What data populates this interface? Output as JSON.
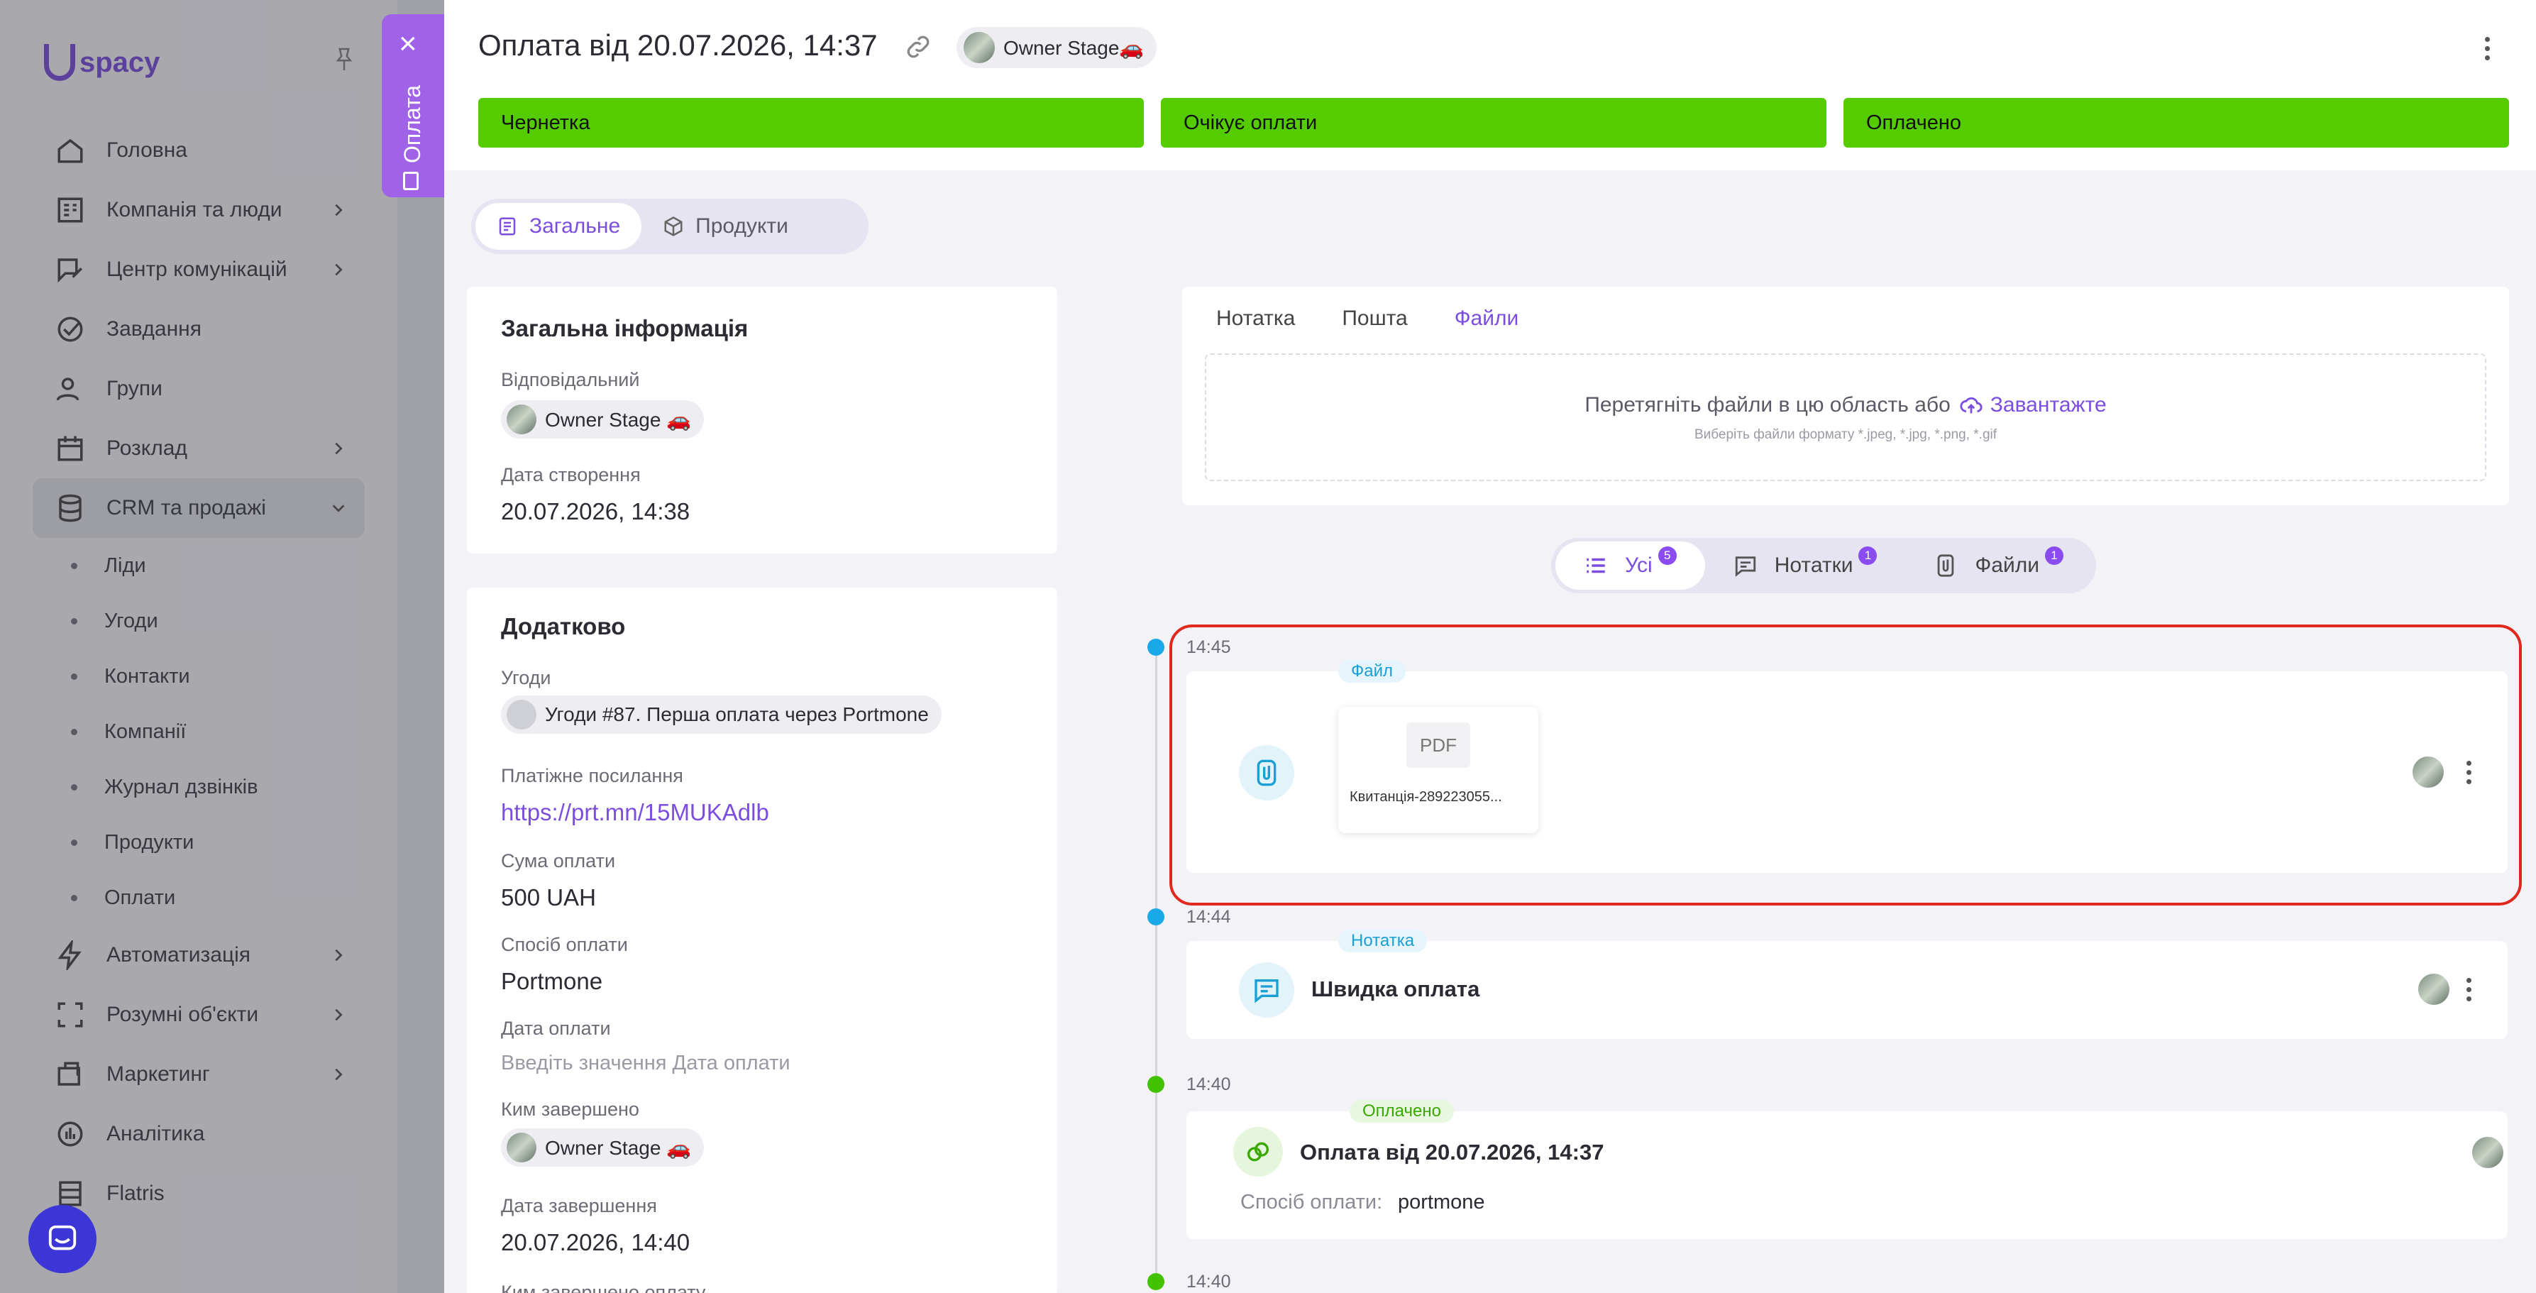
{
  "sidebar": {
    "logo_text": "spacy",
    "items": [
      {
        "label": "Головна",
        "icon": "home-icon"
      },
      {
        "label": "Компанія та люди",
        "icon": "building-icon"
      },
      {
        "label": "Центр комунікацій",
        "icon": "chat-edit-icon"
      },
      {
        "label": "Завдання",
        "icon": "check-circle-icon"
      },
      {
        "label": "Групи",
        "icon": "users-icon"
      },
      {
        "label": "Розклад",
        "icon": "calendar-icon"
      },
      {
        "label": "CRM та продажі",
        "icon": "database-icon"
      }
    ],
    "crm_subitems": [
      "Ліди",
      "Угоди",
      "Контакти",
      "Компанії",
      "Журнал дзвінків",
      "Продукти",
      "Оплати"
    ],
    "items_bottom": [
      {
        "label": "Автоматизація",
        "icon": "bolt-icon"
      },
      {
        "label": "Розумні об'єкти",
        "icon": "scan-icon"
      },
      {
        "label": "Маркетинг",
        "icon": "marketing-icon"
      },
      {
        "label": "Аналітика",
        "icon": "analytics-icon"
      },
      {
        "label": "Flatris",
        "icon": "flatris-icon"
      }
    ]
  },
  "side_tab": {
    "label": "Оплата"
  },
  "header": {
    "title": "Оплата від 20.07.2026, 14:37",
    "owner": "Owner Stage🚗"
  },
  "stages": [
    "Чернетка",
    "Очікує оплати",
    "Оплачено"
  ],
  "tabs": [
    "Загальне",
    "Продукти"
  ],
  "general": {
    "title": "Загальна інформація",
    "responsible_label": "Відповідальний",
    "responsible": "Owner Stage 🚗",
    "created_label": "Дата створення",
    "created": "20.07.2026, 14:38"
  },
  "extra": {
    "title": "Додатково",
    "deals_label": "Угоди",
    "deal": "Угоди #87. Перша оплата через Portmone",
    "paylink_label": "Платіжне посилання",
    "paylink": "https://prt.mn/15MUKAdlb",
    "amount_label": "Сума оплати",
    "amount": "500 UAH",
    "method_label": "Спосіб оплати",
    "method": "Portmone",
    "paydate_label": "Дата оплати",
    "paydate_placeholder": "Введіть значення Дата оплати",
    "completed_by_label": "Ким завершено",
    "completed_by": "Owner Stage 🚗",
    "completed_date_label": "Дата завершення",
    "completed_date": "20.07.2026, 14:40",
    "cut_label": "Ким завершено оплату"
  },
  "upload": {
    "tabs": [
      "Нотатка",
      "Пошта",
      "Файли"
    ],
    "drop_text": "Перетягніть файли в цю область або",
    "upload_link": "Завантажте",
    "hint": "Виберіть файли формату *.jpeg, *.jpg, *.png, *.gif"
  },
  "filter": [
    {
      "label": "Усі",
      "count": "5"
    },
    {
      "label": "Нотатки",
      "count": "1"
    },
    {
      "label": "Файли",
      "count": "1"
    }
  ],
  "timeline": [
    {
      "time": "14:45",
      "tag": "Файл",
      "file_type": "PDF",
      "file_name": "Квитанція-289223055..."
    },
    {
      "time": "14:44",
      "tag": "Нотатка",
      "text": "Швидка оплата"
    },
    {
      "time": "14:40",
      "tag": "Оплачено",
      "title": "Оплата від 20.07.2026, 14:37",
      "method_label": "Спосіб оплати:",
      "method": "portmone"
    },
    {
      "time": "14:40"
    }
  ],
  "colors": {
    "accent": "#7b4ee0",
    "stage": "#54cc00",
    "highlight": "#e0281c",
    "tab": "#a063e8"
  }
}
